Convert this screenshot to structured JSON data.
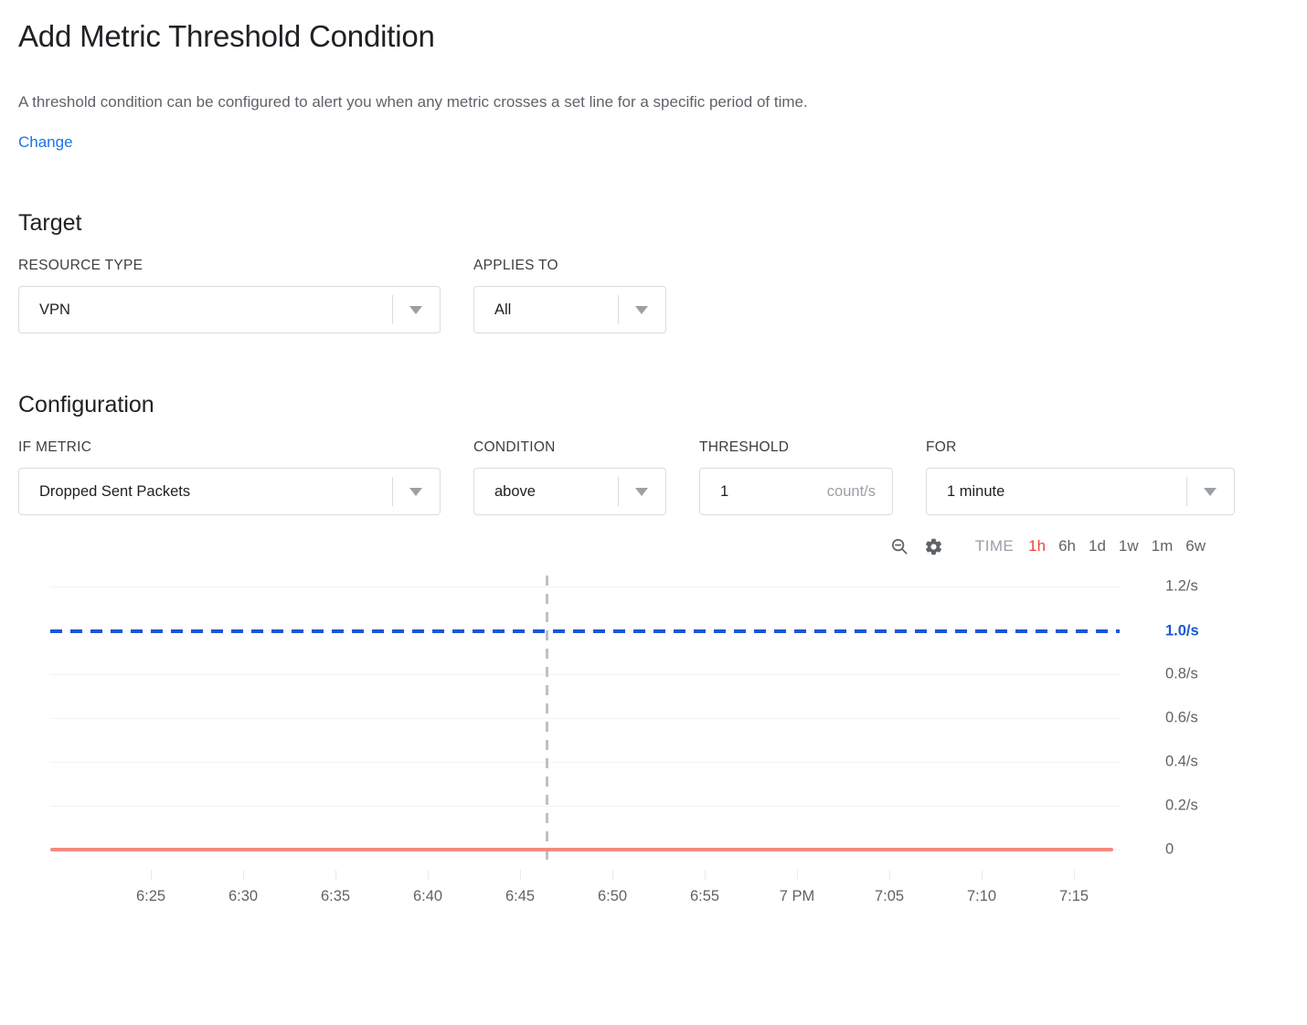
{
  "header": {
    "title": "Add Metric Threshold Condition",
    "description": "A threshold condition can be configured to alert you when any metric crosses a set line for a specific period of time.",
    "change_link": "Change"
  },
  "target": {
    "section_title": "Target",
    "resource_type": {
      "label": "RESOURCE TYPE",
      "value": "VPN"
    },
    "applies_to": {
      "label": "APPLIES TO",
      "value": "All"
    }
  },
  "configuration": {
    "section_title": "Configuration",
    "if_metric": {
      "label": "IF METRIC",
      "value": "Dropped Sent Packets"
    },
    "condition": {
      "label": "CONDITION",
      "value": "above"
    },
    "threshold": {
      "label": "THRESHOLD",
      "value": "1",
      "suffix": "count/s",
      "placeholder": ""
    },
    "for": {
      "label": "FOR",
      "value": "1 minute"
    }
  },
  "chart_toolbar": {
    "zoom_out_icon": "zoom-out-icon",
    "settings_icon": "gear-icon",
    "time_label": "TIME",
    "ranges": [
      {
        "label": "1h",
        "active": true
      },
      {
        "label": "6h",
        "active": false
      },
      {
        "label": "1d",
        "active": false
      },
      {
        "label": "1w",
        "active": false
      },
      {
        "label": "1m",
        "active": false
      },
      {
        "label": "6w",
        "active": false
      }
    ],
    "active_color": "#e8453c"
  },
  "chart_data": {
    "type": "line",
    "title": "",
    "xlabel": "",
    "ylabel": "",
    "grid": true,
    "legend": "none",
    "x": [
      "6:25",
      "6:30",
      "6:35",
      "6:40",
      "6:45",
      "6:50",
      "6:55",
      "7 PM",
      "7:05",
      "7:10",
      "7:15"
    ],
    "ytick_labels": [
      "1.2/s",
      "1.0/s",
      "0.8/s",
      "0.6/s",
      "0.4/s",
      "0.2/s",
      "0"
    ],
    "ytick_values": [
      1.2,
      1.0,
      0.8,
      0.6,
      0.4,
      0.2,
      0
    ],
    "ylim": [
      0,
      1.2
    ],
    "series": [
      {
        "name": "Dropped Sent Packets",
        "color": "#f28b82",
        "values": [
          0,
          0,
          0,
          0,
          0,
          0,
          0,
          0,
          0,
          0,
          0
        ]
      }
    ],
    "threshold_line": {
      "value": 1.0,
      "label": "1.0/s",
      "color": "#1a56d6",
      "style": "dashed"
    },
    "cursor_marker": {
      "x": "6:46",
      "color": "#bdc1c6",
      "style": "dashed"
    }
  }
}
